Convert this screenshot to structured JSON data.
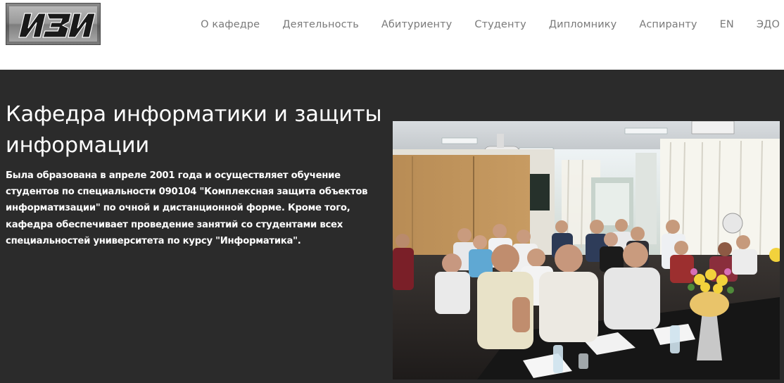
{
  "header": {
    "logo_text": "ИЗИ",
    "nav": [
      {
        "label": "О кафедре"
      },
      {
        "label": "Деятельность"
      },
      {
        "label": "Абитуриенту"
      },
      {
        "label": "Студенту"
      },
      {
        "label": "Дипломнику"
      },
      {
        "label": "Аспиранту"
      },
      {
        "label": "EN"
      },
      {
        "label": "ЭДО"
      }
    ]
  },
  "hero": {
    "title": "Кафедра информатики и защиты информации",
    "description": "Была образована в апреле 2001 года и осуществляет обучение студентов по специальности 090104 \"Комплексная защита объектов информатизации\" по очной и дистанционной форме. Кроме того, кафедра обеспечивает проведение занятий со студентами всех специальностей университета по курсу \"Информатика\".",
    "photo_icon": "classroom-photo"
  },
  "colors": {
    "hero_background": "#2b2b2b",
    "nav_text": "#7a7a7a",
    "hero_text": "#ffffff"
  }
}
